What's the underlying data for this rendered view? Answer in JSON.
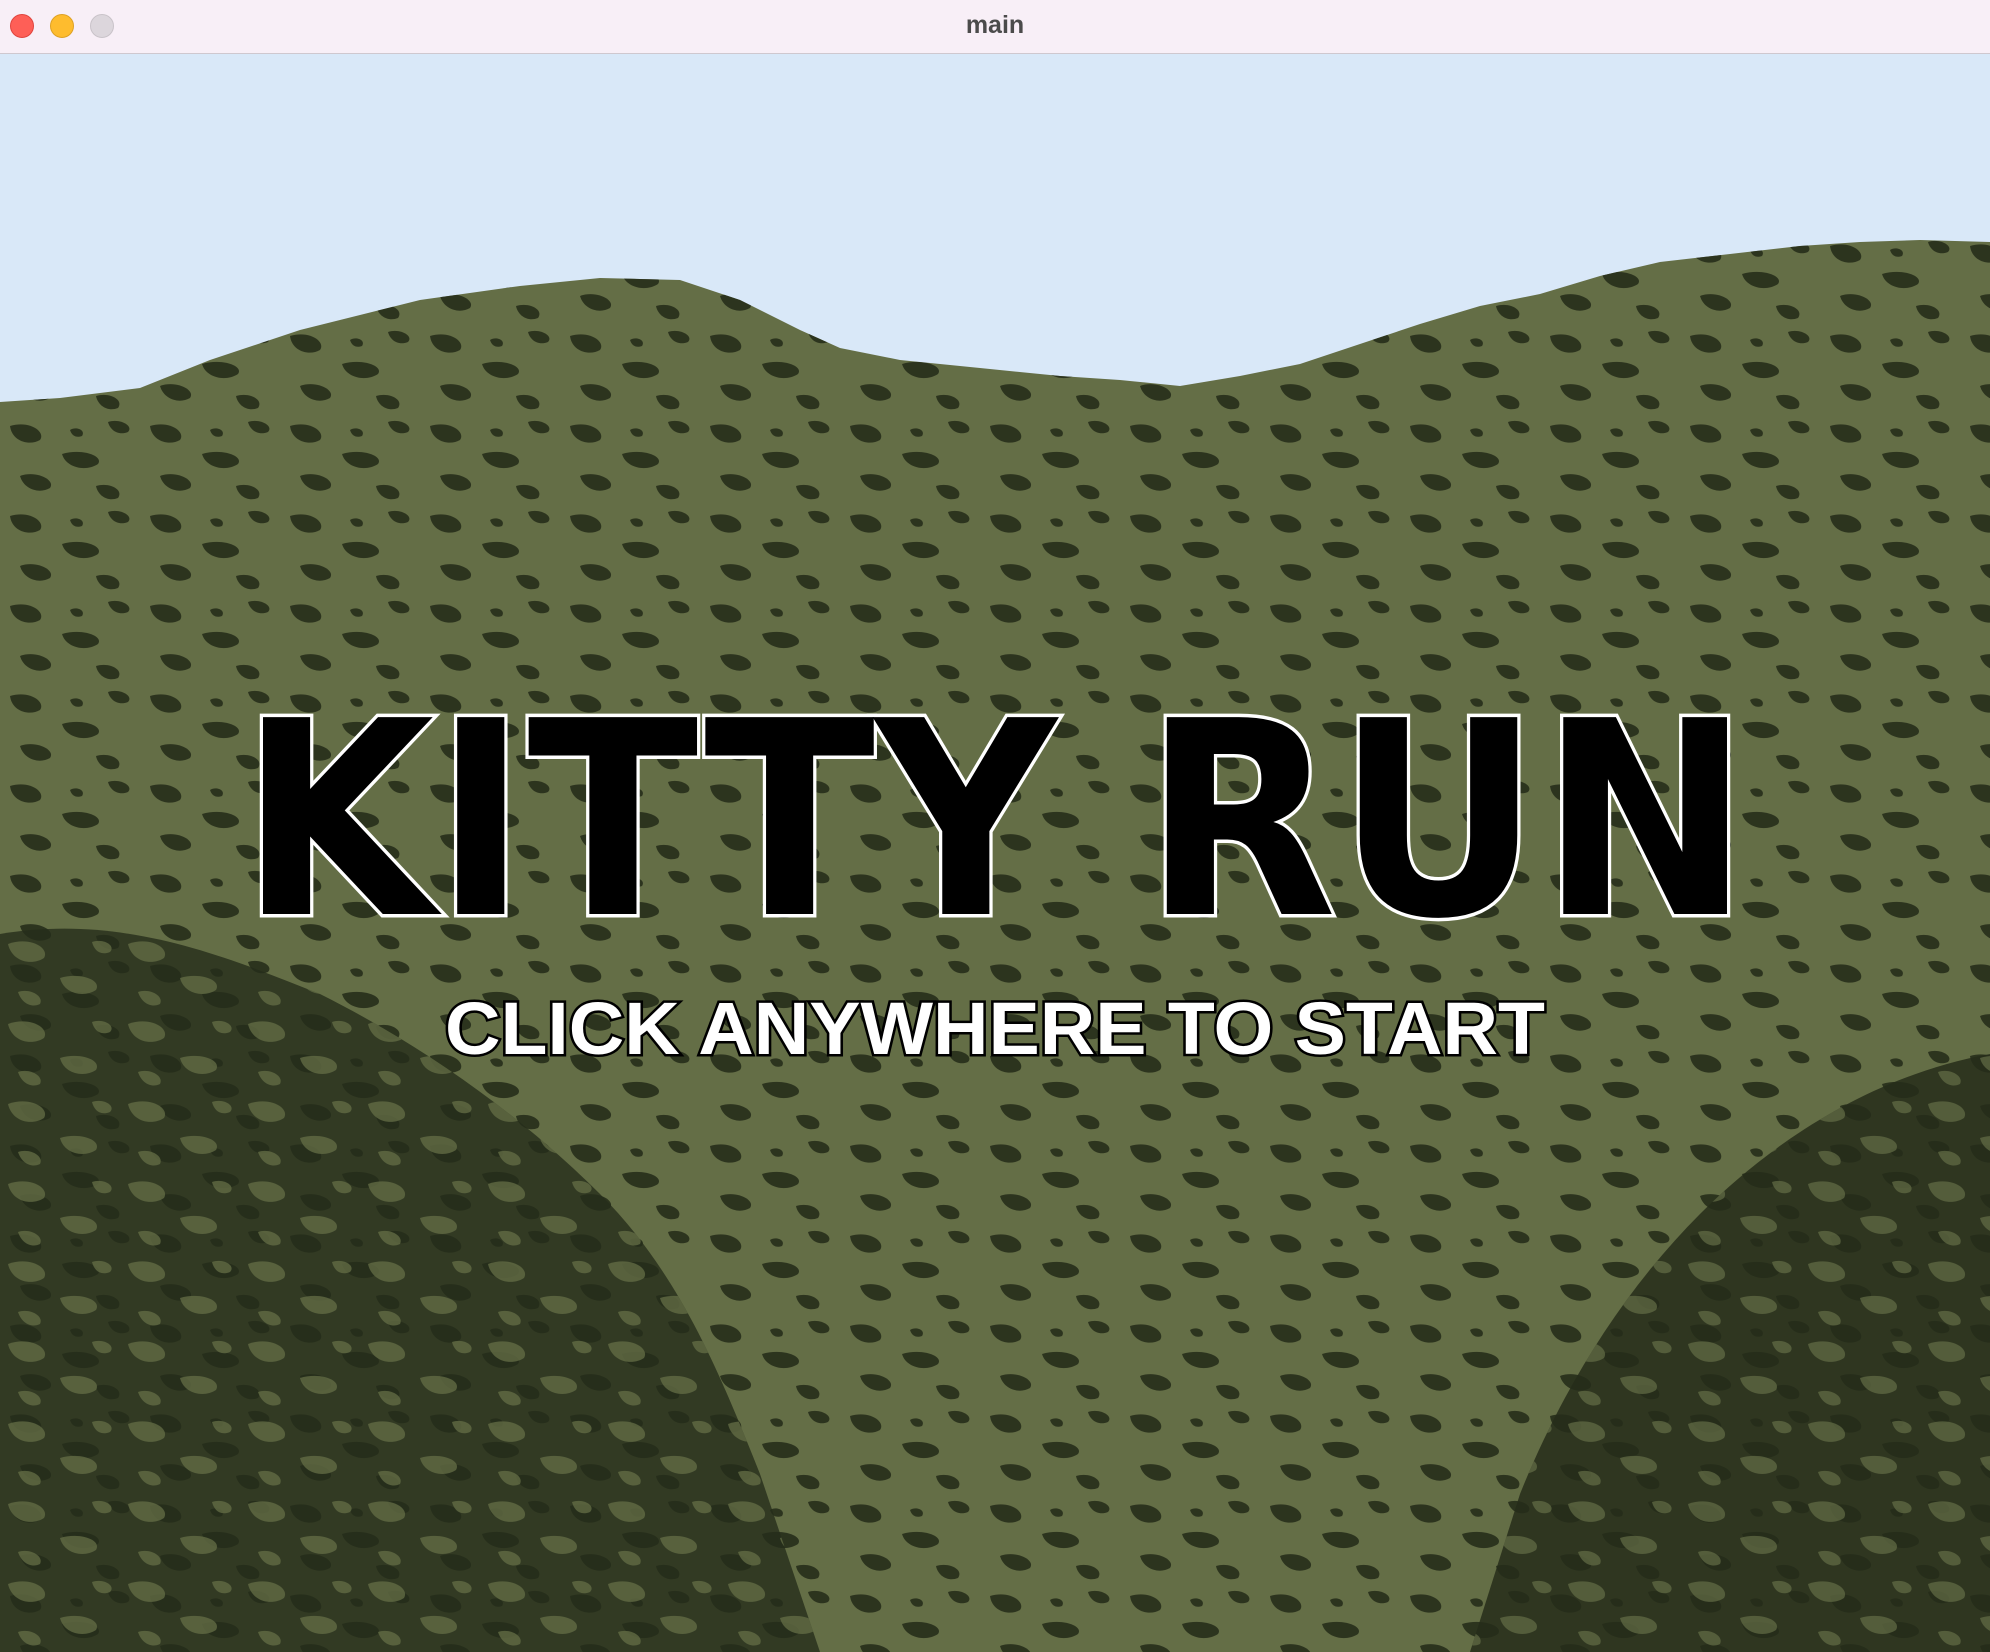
{
  "window": {
    "title": "main",
    "buttons": [
      "close",
      "minimize",
      "zoom"
    ]
  },
  "game": {
    "title": "KITTY RUN",
    "start_prompt": "CLICK ANYWHERE TO START",
    "colors": {
      "sky": "#d9e8f8",
      "hill_light": "#646e46",
      "hill_dark": "#262d1a",
      "title_fill": "#000000",
      "title_outline": "#ffffff",
      "prompt_fill": "#ffffff",
      "prompt_outline": "#000000"
    }
  }
}
